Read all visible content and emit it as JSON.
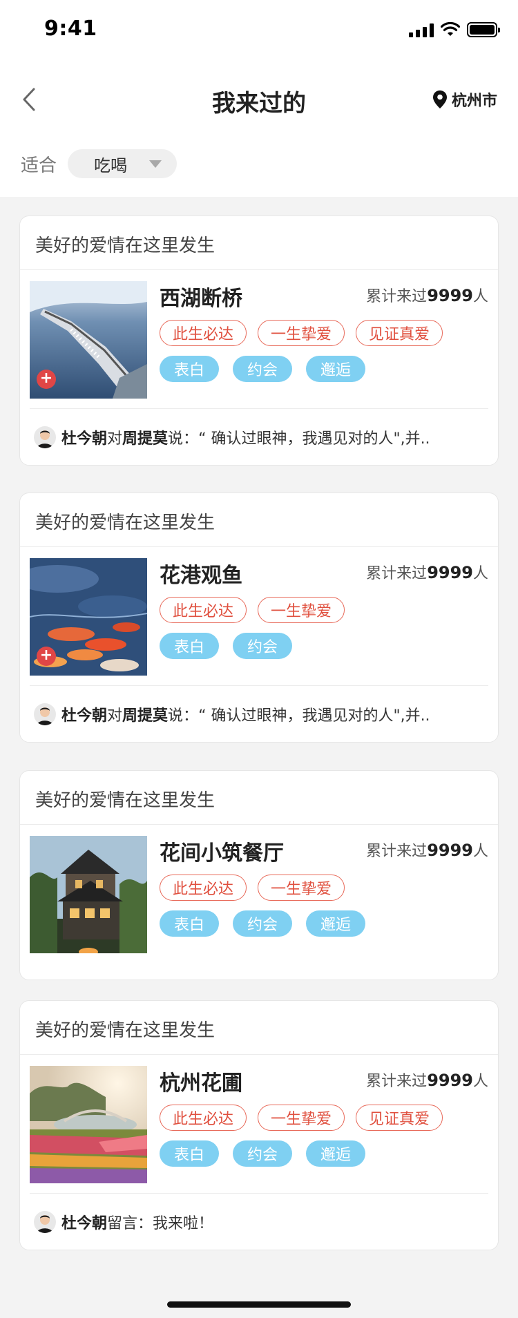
{
  "status": {
    "time": "9:41"
  },
  "nav": {
    "title": "我来过的",
    "location": "杭州市"
  },
  "filter": {
    "label": "适合",
    "value": "吃喝"
  },
  "cards": [
    {
      "header": "美好的爱情在这里发生",
      "name": "西湖断桥",
      "count_prefix": "累计来过",
      "count": "9999",
      "count_suffix": "人",
      "tags_red": [
        "此生必达",
        "一生挚爱",
        "见证真爱"
      ],
      "tags_blue": [
        "表白",
        "约会",
        "邂逅"
      ],
      "footer": {
        "user": "杜今朝",
        "mid": "对",
        "target": "周提莫",
        "verb": "说：",
        "text": "“ 确认过眼神，我遇见对的人\",并.."
      }
    },
    {
      "header": "美好的爱情在这里发生",
      "name": "花港观鱼",
      "count_prefix": "累计来过",
      "count": "9999",
      "count_suffix": "人",
      "tags_red": [
        "此生必达",
        "一生挚爱"
      ],
      "tags_blue": [
        "表白",
        "约会"
      ],
      "footer": {
        "user": "杜今朝",
        "mid": "对",
        "target": "周提莫",
        "verb": "说：",
        "text": "“ 确认过眼神，我遇见对的人\",并.."
      }
    },
    {
      "header": "美好的爱情在这里发生",
      "name": "花间小筑餐厅",
      "count_prefix": "累计来过",
      "count": "9999",
      "count_suffix": "人",
      "tags_red": [
        "此生必达",
        "一生挚爱"
      ],
      "tags_blue": [
        "表白",
        "约会",
        "邂逅"
      ]
    },
    {
      "header": "美好的爱情在这里发生",
      "name": "杭州花圃",
      "count_prefix": "累计来过",
      "count": "9999",
      "count_suffix": "人",
      "tags_red": [
        "此生必达",
        "一生挚爱",
        "见证真爱"
      ],
      "tags_blue": [
        "表白",
        "约会",
        "邂逅"
      ],
      "footer": {
        "user": "杜今朝",
        "verb": "留言：",
        "text": "我来啦！"
      }
    }
  ],
  "colors": {
    "accent_red": "#e0503f",
    "tag_blue": "#7fd0f2",
    "badge_red": "#e04646"
  },
  "icons": [
    "back-chevron-icon",
    "location-pin-icon",
    "dropdown-triangle-icon",
    "add-icon",
    "avatar"
  ]
}
